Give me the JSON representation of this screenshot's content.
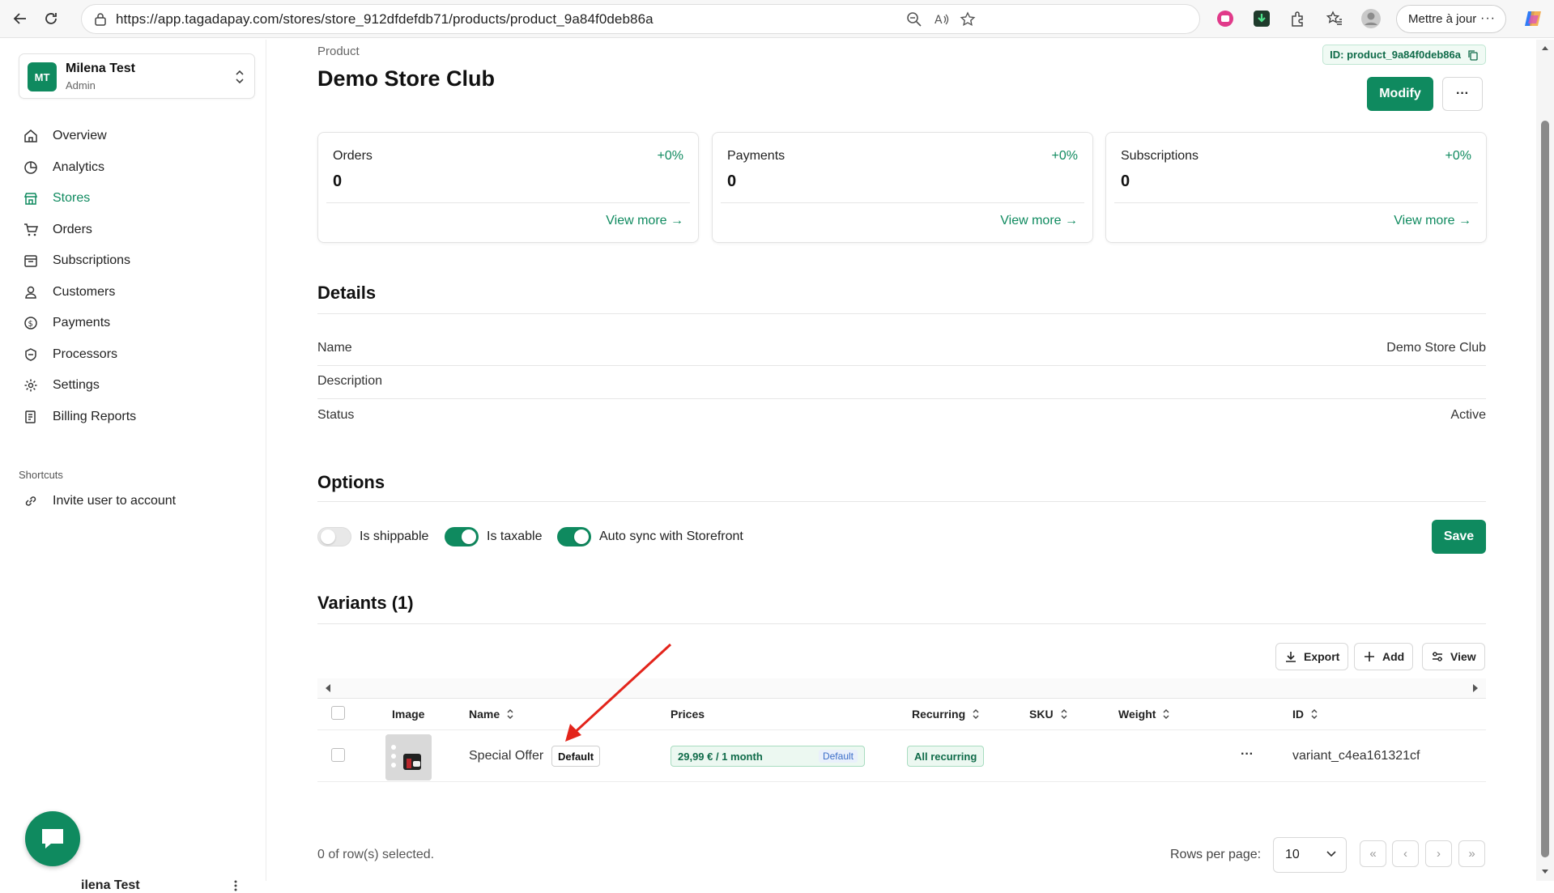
{
  "browser": {
    "url": "https://app.tagadapay.com/stores/store_912dfdefdb71/products/product_9a84f0deb86a",
    "update_label": "Mettre à jour"
  },
  "sidebar": {
    "account": {
      "initials": "MT",
      "name": "Milena Test",
      "role": "Admin"
    },
    "items": [
      {
        "label": "Overview",
        "icon": "home-icon"
      },
      {
        "label": "Analytics",
        "icon": "pie-chart-icon"
      },
      {
        "label": "Stores",
        "icon": "store-icon",
        "active": true
      },
      {
        "label": "Orders",
        "icon": "cart-icon"
      },
      {
        "label": "Subscriptions",
        "icon": "calendar-icon"
      },
      {
        "label": "Customers",
        "icon": "user-icon"
      },
      {
        "label": "Payments",
        "icon": "coin-icon"
      },
      {
        "label": "Processors",
        "icon": "processor-icon"
      },
      {
        "label": "Settings",
        "icon": "gear-icon"
      },
      {
        "label": "Billing Reports",
        "icon": "report-icon"
      }
    ],
    "shortcuts_label": "Shortcuts",
    "shortcut": {
      "label": "Invite user to account",
      "icon": "link-icon"
    },
    "footer_name": "ilena Test"
  },
  "header": {
    "breadcrumb": "Product",
    "title": "Demo Store Club",
    "id_chip": "ID: product_9a84f0deb86a",
    "modify_label": "Modify",
    "more_label": "···"
  },
  "stats": [
    {
      "label": "Orders",
      "value": "0",
      "delta": "+0%",
      "link": "View more →"
    },
    {
      "label": "Payments",
      "value": "0",
      "delta": "+0%",
      "link": "View more →"
    },
    {
      "label": "Subscriptions",
      "value": "0",
      "delta": "+0%",
      "link": "View more →"
    }
  ],
  "details": {
    "title": "Details",
    "rows": [
      {
        "label": "Name",
        "value": "Demo Store Club"
      },
      {
        "label": "Description",
        "value": ""
      },
      {
        "label": "Status",
        "value": "Active"
      }
    ]
  },
  "options": {
    "title": "Options",
    "toggles": [
      {
        "label": "Is shippable",
        "on": false
      },
      {
        "label": "Is taxable",
        "on": true
      },
      {
        "label": "Auto sync with Storefront",
        "on": true
      }
    ],
    "save_label": "Save"
  },
  "variants": {
    "title": "Variants (1)",
    "export_label": "Export",
    "add_label": "Add",
    "view_label": "View",
    "columns": [
      "Image",
      "Name",
      "Prices",
      "Recurring",
      "SKU",
      "Weight",
      "ID"
    ],
    "rows": [
      {
        "name": "Special Offer",
        "name_badge": "Default",
        "price": "29,99 € / 1 month",
        "price_badge": "Default",
        "recurring": "All recurring",
        "sku": "",
        "weight": "",
        "actions": "···",
        "id": "variant_c4ea161321cf"
      }
    ],
    "selected_text": "0 of row(s) selected.",
    "rows_per_page_label": "Rows per page:",
    "rows_per_page_value": "10",
    "pager": {
      "first": "«",
      "prev": "‹",
      "next": "›",
      "last": "»"
    }
  },
  "colors": {
    "brand": "#0f8a5f",
    "annotation_arrow": "#e3241b"
  }
}
